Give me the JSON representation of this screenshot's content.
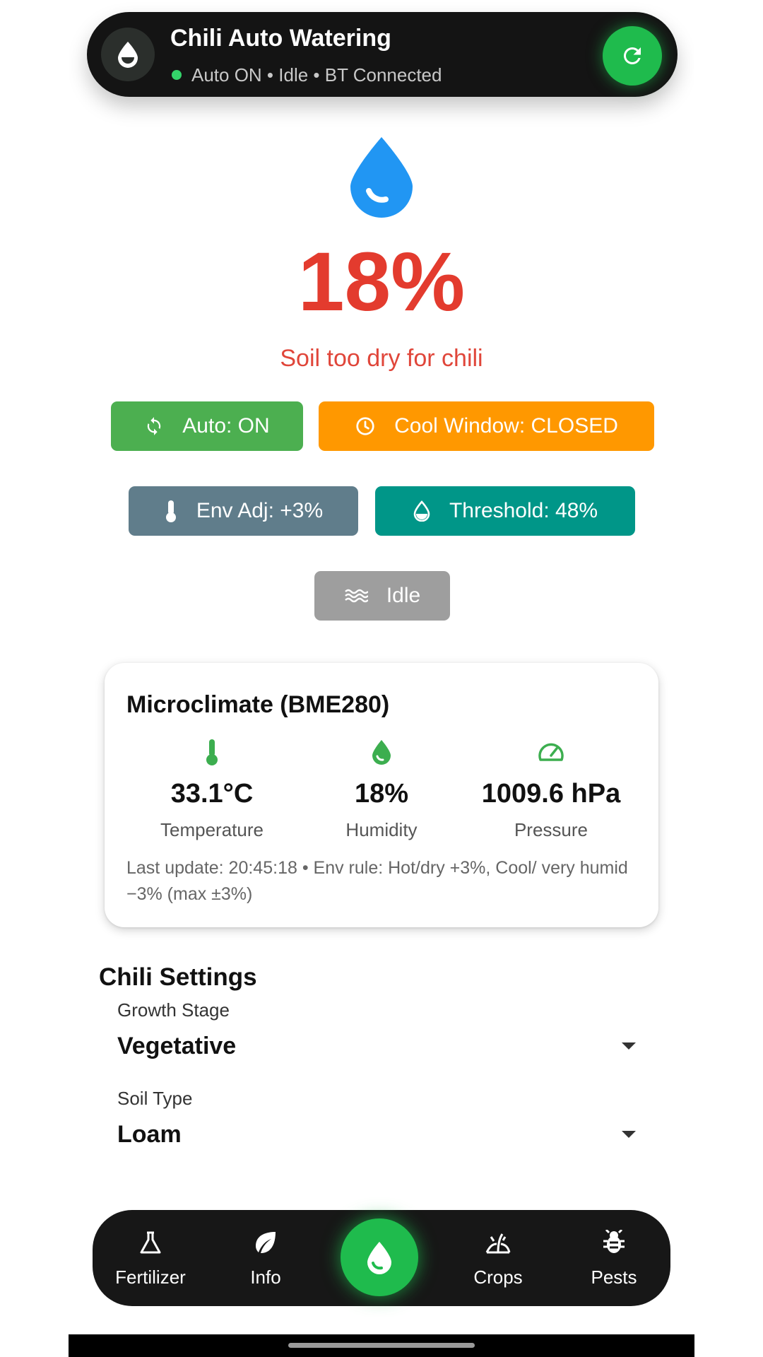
{
  "header": {
    "title": "Chili Auto Watering",
    "status": "Auto ON • Idle • BT Connected",
    "status_dot_color": "#34d36a",
    "refresh_icon": "refresh-icon",
    "app_icon": "water-drop-icon"
  },
  "moisture": {
    "value": "18%",
    "message": "Soil too dry for chili",
    "color": "#e33b2e"
  },
  "chips": {
    "auto": {
      "label": "Auto: ON",
      "color": "#4caf50",
      "icon": "sync-icon"
    },
    "cool_window": {
      "label": "Cool Window: CLOSED",
      "color": "#ff9800",
      "icon": "clock-icon"
    },
    "env_adj": {
      "label": "Env Adj: +3%",
      "color": "#607d8b",
      "icon": "thermometer-icon"
    },
    "threshold": {
      "label": "Threshold: 48%",
      "color": "#009688",
      "icon": "water-drop-icon"
    },
    "pump": {
      "label": "Idle",
      "color": "#9e9e9e",
      "icon": "waves-icon"
    }
  },
  "microclimate": {
    "title": "Microclimate (BME280)",
    "temperature": {
      "value": "33.1°C",
      "label": "Temperature"
    },
    "humidity": {
      "value": "18%",
      "label": "Humidity"
    },
    "pressure": {
      "value": "1009.6 hPa",
      "label": "Pressure"
    },
    "note": "Last update: 20:45:18 • Env rule: Hot/dry +3%, Cool/ very humid −3% (max ±3%)",
    "icon_color": "#3cae4f"
  },
  "settings": {
    "title": "Chili Settings",
    "growth_stage": {
      "label": "Growth Stage",
      "value": "Vegetative"
    },
    "soil_type": {
      "label": "Soil Type",
      "value": "Loam"
    }
  },
  "nav": {
    "fertilizer": "Fertilizer",
    "info": "Info",
    "crops": "Crops",
    "pests": "Pests",
    "center_icon": "water-drop-icon"
  }
}
